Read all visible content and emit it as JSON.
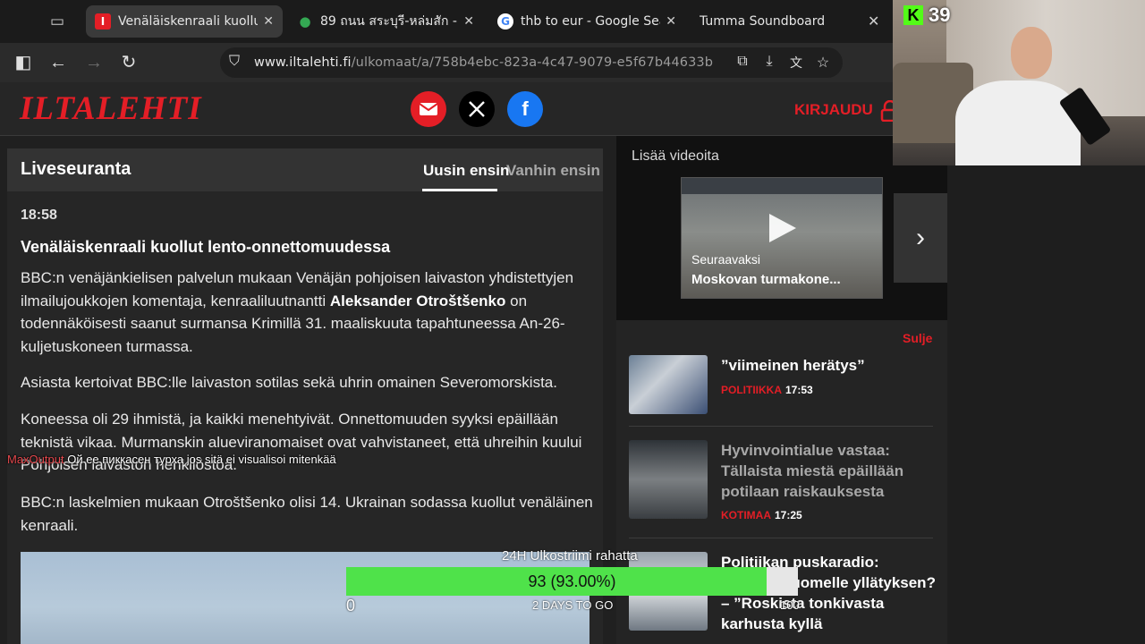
{
  "browser": {
    "tabs": [
      {
        "label": "Venäläiskenraali kuollut lento",
        "favicon": "iltalehti-favicon",
        "favicon_color": "#e41e26",
        "active": true
      },
      {
        "label": "89 ถนน สระบุรี-หล่มสัก - Goog",
        "favicon": "map-pin-favicon",
        "favicon_color": "#34a853",
        "active": false
      },
      {
        "label": "thb to eur - Google Search",
        "favicon": "google-favicon",
        "favicon_color": "#4285f4",
        "active": false
      },
      {
        "label": "Tumma Soundboard",
        "favicon": "",
        "active": false
      }
    ],
    "url_host": "www.iltalehti.fi",
    "url_path": "/ulkomaat/a/758b4ebc-823a-4c47-9079-e5f67b44633b"
  },
  "site": {
    "logo": "ILTALEHTI",
    "login": "KIRJAUDU",
    "social": [
      "email",
      "x",
      "facebook"
    ],
    "colors": {
      "brand": "#e41e26",
      "email": "#e41e26",
      "x": "#000000",
      "facebook": "#1877f2"
    }
  },
  "live": {
    "title": "Liveseuranta",
    "sort_newest": "Uusin ensin",
    "sort_oldest": "Vanhin ensin",
    "time": "18:58",
    "headline": "Venäläiskenraali kuollut lento-onnettomuudessa",
    "p1_a": "BBC:n venäjänkielisen palvelun mukaan Venäjän pohjoisen laivaston yhdistettyjen ilmailujoukkojen komentaja, kenraaliluutnantti ",
    "p1_bold": "Aleksander Otroštšenko",
    "p1_b": " on todennäköisesti saanut surmansa Krimillä 31. maaliskuuta tapahtuneessa An-26-kuljetuskoneen turmassa.",
    "p2": "Asiasta kertoivat BBC:lle laivaston sotilas sekä uhrin omainen Severomorskista.",
    "p3": "Koneessa oli 29 ihmistä, ja kaikki menehtyivät. Onnettomuuden syyksi epäillään teknistä vikaa. Murmanskin alueviranomaiset ovat vahvistaneet, että uhreihin kuului Pohjoisen laivaston henkilöstöä.",
    "p4": "BBC:n laskelmien mukaan Otroštšenko olisi 14. Ukrainan sodassa kuollut venäläinen kenraali."
  },
  "videos": {
    "title": "Lisää videoita",
    "next_label": "Seuraavaksi",
    "caption": "Moskovan turmakone..."
  },
  "news": {
    "close": "Sulje",
    "items": [
      {
        "title": "”viimeinen herätys”",
        "category": "Politiikka",
        "time": "17:53",
        "read": false
      },
      {
        "title": "Hyvinvointialue vastaa: Tällaista miestä epäillään potilaan raiskauksesta",
        "category": "Kotimaa",
        "time": "17:25",
        "read": true
      },
      {
        "title": "Politiikan puskaradio: ...roonit Suomelle yllätyksen? – ”Roskista tonkivasta karhusta kyllä",
        "category": "",
        "time": "",
        "read": false
      }
    ]
  },
  "stream": {
    "viewer_count": "39",
    "platform_badge": "K",
    "platform_color": "#53fc18",
    "chat_user": "MaxOutput",
    "chat_message": "Ой ее пиккасен турха jos sitä ei visualisoi mitenkää",
    "goal_title": "24H Ulkostriimi rahatta",
    "goal_value": "93 (93.00%)",
    "goal_fraction": 0.93,
    "goal_min": "0",
    "goal_remaining": "2 DAYS TO GO",
    "goal_max": "100"
  }
}
